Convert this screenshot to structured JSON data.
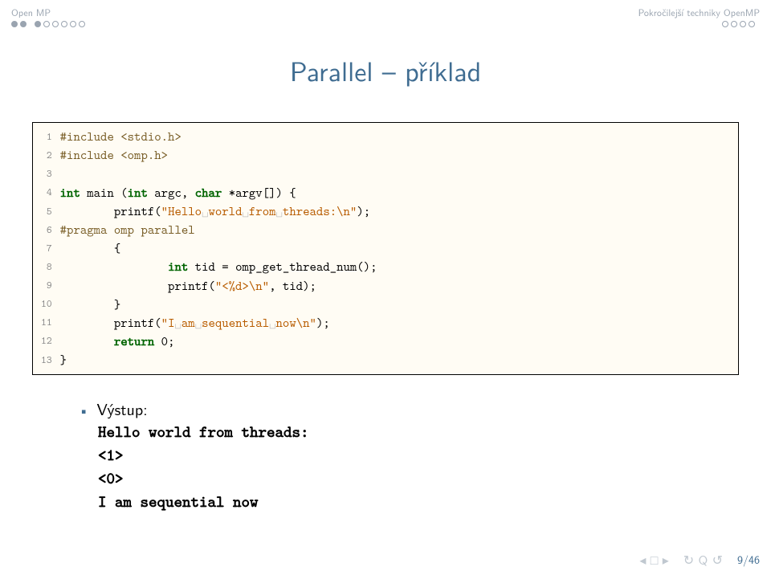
{
  "header": {
    "left": "Open MP",
    "right": "Pokročilejší techniky OpenMP"
  },
  "title": "Parallel – příklad",
  "code": {
    "lines": [
      {
        "n": "1",
        "pp": "#include <stdio.h>"
      },
      {
        "n": "2",
        "pp": "#include <omp.h>"
      },
      {
        "n": "3",
        "blank": true
      },
      {
        "n": "4",
        "kw": "int",
        "rest": " main (",
        "kw2": "int",
        "rest2": " argc, ",
        "kw3": "char",
        "rest3": " *argv[]) {"
      },
      {
        "n": "5",
        "indent": "        ",
        "fn": "printf(",
        "str": "\"Hello␣world␣from␣threads:\\n\"",
        "tail": ");"
      },
      {
        "n": "6",
        "pp": "#pragma omp parallel"
      },
      {
        "n": "7",
        "indent": "        ",
        "text": "{"
      },
      {
        "n": "8",
        "indent": "                ",
        "kw": "int",
        "rest": " tid = omp_get_thread_num();"
      },
      {
        "n": "9",
        "indent": "                ",
        "fn": "printf(",
        "str": "\"<%d>\\n\"",
        "tail": ", tid);"
      },
      {
        "n": "10",
        "indent": "        ",
        "text": "}"
      },
      {
        "n": "11",
        "indent": "        ",
        "fn": "printf(",
        "str": "\"I␣am␣sequential␣now\\n\"",
        "tail": ");"
      },
      {
        "n": "12",
        "indent": "        ",
        "kw": "return",
        "rest": " 0;"
      },
      {
        "n": "13",
        "text": "}"
      }
    ]
  },
  "output": {
    "label": "Výstup:",
    "lines": [
      "Hello world from threads:",
      "<1>",
      "<0>",
      "I am sequential now"
    ]
  },
  "footer": {
    "page": "9/46"
  }
}
